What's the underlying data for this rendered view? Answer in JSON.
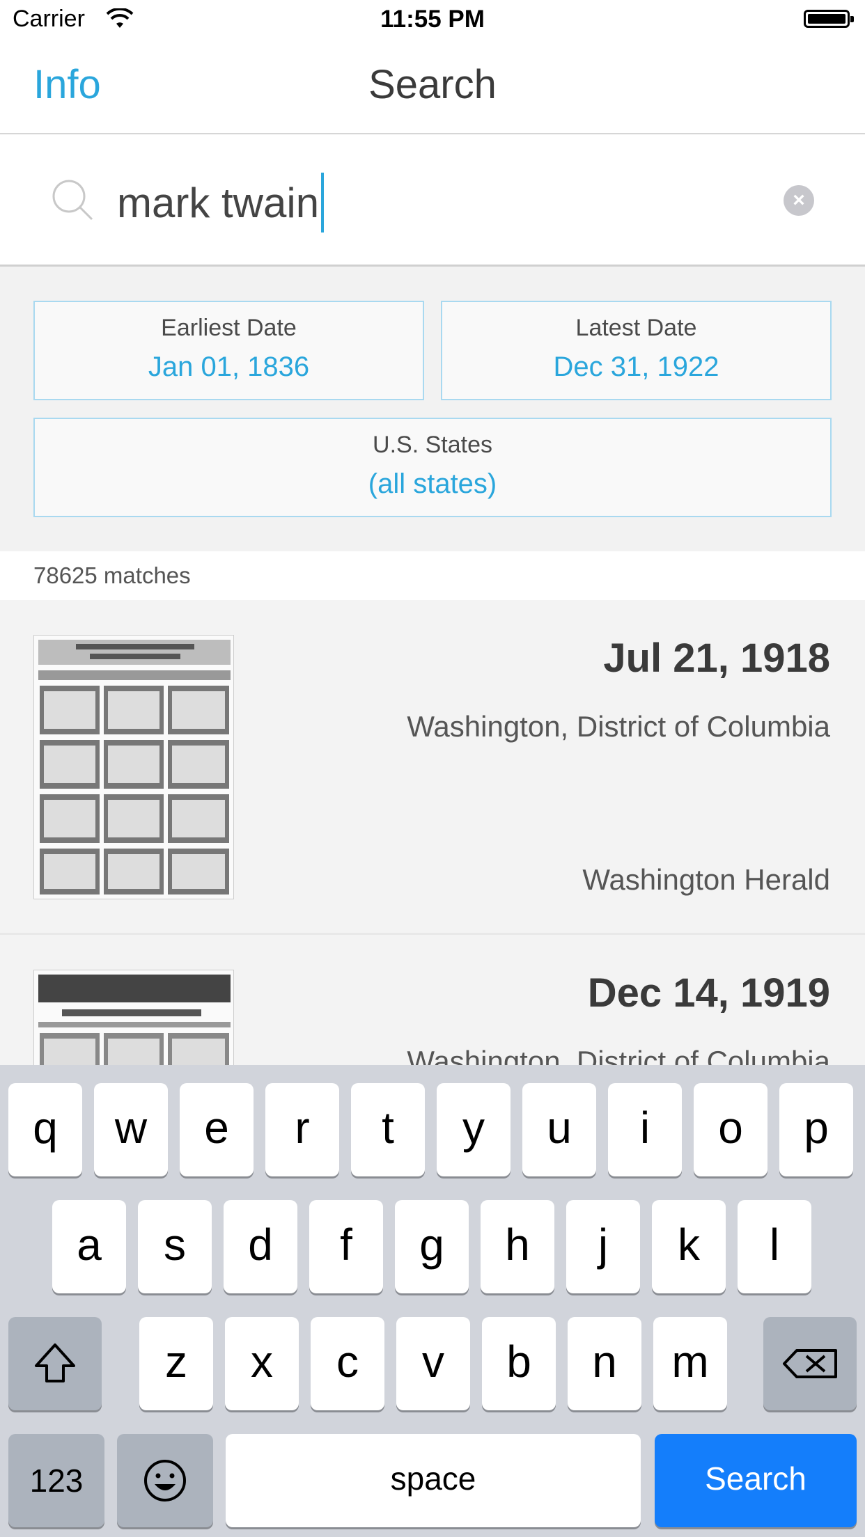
{
  "status_bar": {
    "carrier": "Carrier",
    "time": "11:55 PM"
  },
  "nav": {
    "left_label": "Info",
    "title": "Search"
  },
  "search": {
    "query": "mark twain"
  },
  "filters": {
    "earliest": {
      "label": "Earliest Date",
      "value": "Jan 01, 1836"
    },
    "latest": {
      "label": "Latest Date",
      "value": "Dec 31, 1922"
    },
    "states": {
      "label": "U.S. States",
      "value": "(all states)"
    }
  },
  "matches_text": "78625 matches",
  "results": [
    {
      "date": "Jul 21, 1918",
      "place": "Washington, District of Columbia",
      "paper": "Washington Herald"
    },
    {
      "date": "Dec 14, 1919",
      "place": "Washington, District of Columbia"
    }
  ],
  "keyboard": {
    "row1": [
      "q",
      "w",
      "e",
      "r",
      "t",
      "y",
      "u",
      "i",
      "o",
      "p"
    ],
    "row2": [
      "a",
      "s",
      "d",
      "f",
      "g",
      "h",
      "j",
      "k",
      "l"
    ],
    "row3": [
      "z",
      "x",
      "c",
      "v",
      "b",
      "n",
      "m"
    ],
    "numbers_label": "123",
    "space_label": "space",
    "action_label": "Search"
  },
  "colors": {
    "accent": "#2aa6dc",
    "search_key": "#147efb",
    "keyboard_bg": "#d1d4db"
  }
}
